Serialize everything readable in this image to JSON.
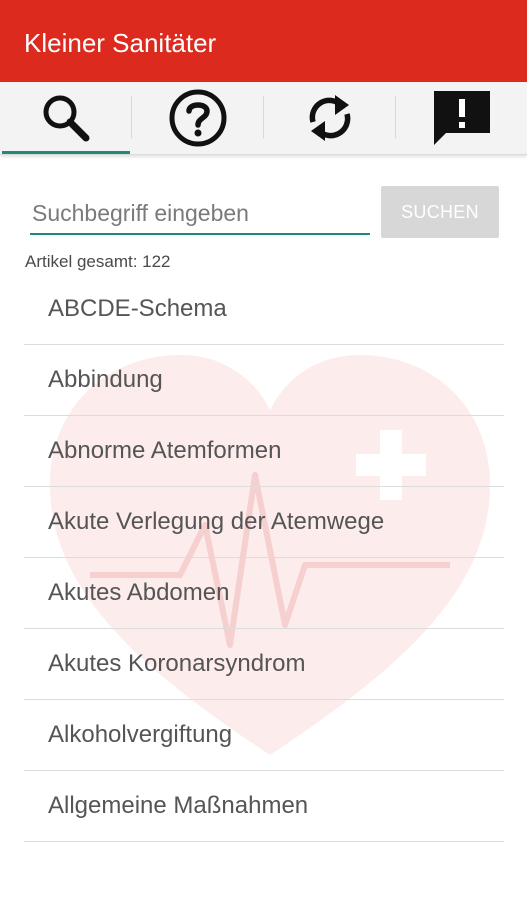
{
  "app": {
    "title": "Kleiner Sanitäter"
  },
  "tabs": [
    {
      "icon": "search-icon",
      "active": true
    },
    {
      "icon": "help-icon",
      "active": false
    },
    {
      "icon": "sync-icon",
      "active": false
    },
    {
      "icon": "feedback-icon",
      "active": false
    }
  ],
  "search": {
    "placeholder": "Suchbegriff eingeben",
    "value": "",
    "button_label": "SUCHEN"
  },
  "count_text": "Artikel gesamt: 122",
  "articles": [
    "ABCDE-Schema",
    "Abbindung",
    "Abnorme Atemformen",
    "Akute Verlegung der Atemwege",
    "Akutes Abdomen",
    "Akutes Koronarsyndrom",
    "Alkoholvergiftung",
    "Allgemeine Maßnahmen"
  ],
  "colors": {
    "appbar": "#dc2a1f",
    "accent": "#1e8a7a",
    "background_heart": "#fde8e8"
  }
}
